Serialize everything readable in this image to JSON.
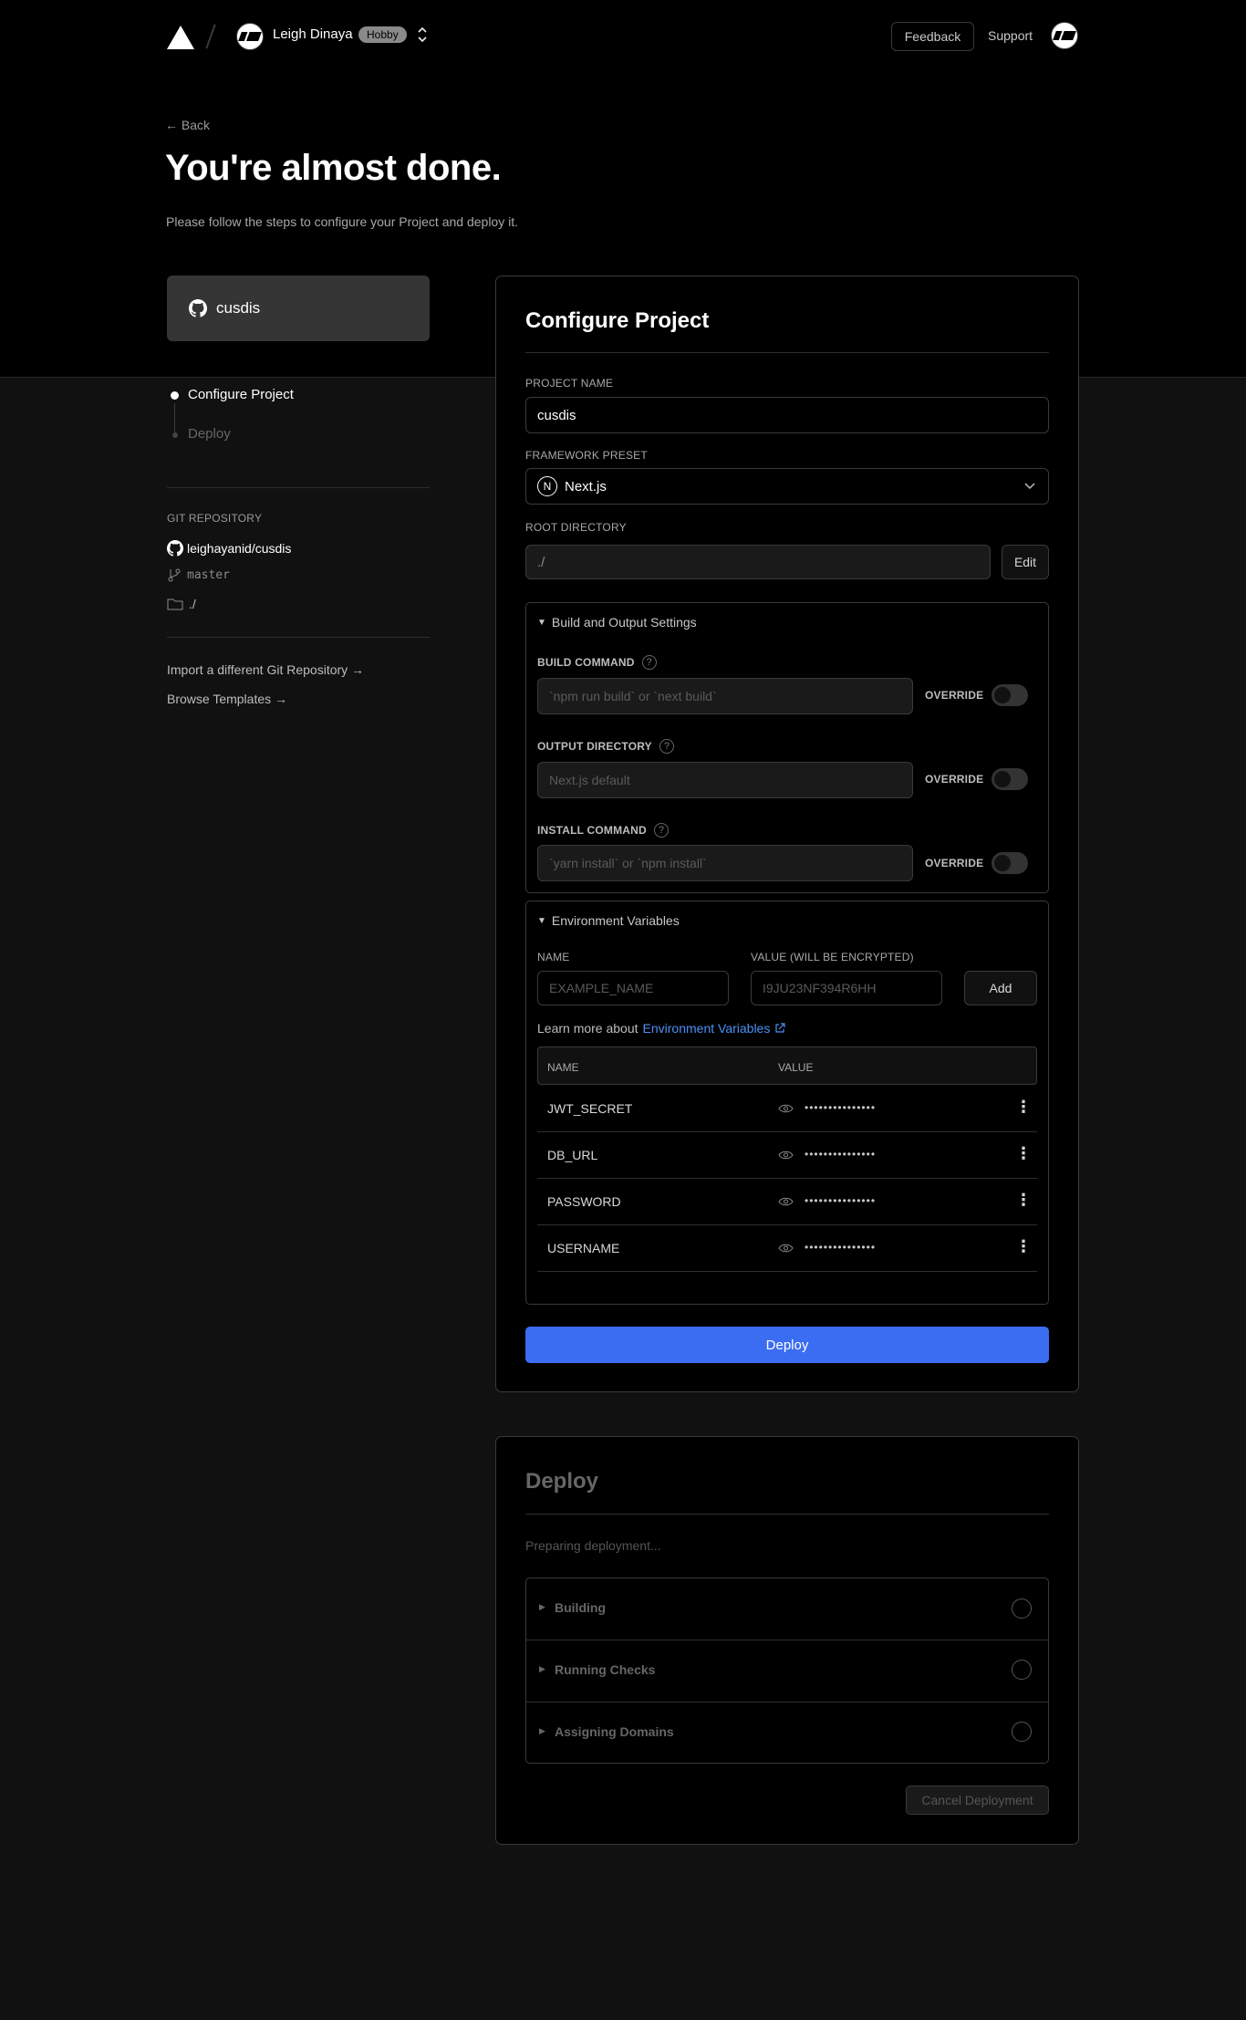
{
  "header": {
    "user_name": "Leigh Dinaya",
    "plan_badge": "Hobby",
    "feedback_label": "Feedback",
    "support_label": "Support"
  },
  "hero": {
    "back_label": "Back",
    "title": "You're almost done.",
    "subtitle": "Please follow the steps to configure your Project and deploy it."
  },
  "sidebar": {
    "repo_card_name": "cusdis",
    "steps": [
      {
        "label": "Configure Project",
        "active": true
      },
      {
        "label": "Deploy",
        "active": false
      }
    ],
    "git_section_label": "GIT REPOSITORY",
    "repo_full_name": "leighayanid/cusdis",
    "branch": "master",
    "directory": "./",
    "links": [
      "Import a different Git Repository →",
      "Browse Templates →"
    ]
  },
  "configure": {
    "title": "Configure Project",
    "project_name_label": "PROJECT NAME",
    "project_name_value": "cusdis",
    "framework_label": "FRAMEWORK PRESET",
    "framework_value": "Next.js",
    "root_dir_label": "ROOT DIRECTORY",
    "root_dir_value": "./",
    "edit_label": "Edit",
    "build_section_title": "Build and Output Settings",
    "build_command_label": "BUILD COMMAND",
    "build_command_placeholder": "`npm run build` or `next build`",
    "output_dir_label": "OUTPUT DIRECTORY",
    "output_dir_placeholder": "Next.js default",
    "install_command_label": "INSTALL COMMAND",
    "install_command_placeholder": "`yarn install` or `npm install`",
    "override_label": "OVERRIDE",
    "env_section_title": "Environment Variables",
    "env_name_label": "NAME",
    "env_value_label": "VALUE (WILL BE ENCRYPTED)",
    "env_name_placeholder": "EXAMPLE_NAME",
    "env_value_placeholder": "I9JU23NF394R6HH",
    "add_label": "Add",
    "learn_more_prefix": "Learn more about",
    "learn_more_link": "Environment Variables",
    "table_header_name": "NAME",
    "table_header_value": "VALUE",
    "env_vars": [
      {
        "name": "JWT_SECRET",
        "value": "•••••••••••••••"
      },
      {
        "name": "DB_URL",
        "value": "•••••••••••••••"
      },
      {
        "name": "PASSWORD",
        "value": "•••••••••••••••"
      },
      {
        "name": "USERNAME",
        "value": "•••••••••••••••"
      }
    ],
    "deploy_button": "Deploy"
  },
  "deploy": {
    "title": "Deploy",
    "status": "Preparing deployment...",
    "steps": [
      "Building",
      "Running Checks",
      "Assigning Domains"
    ],
    "cancel_label": "Cancel Deployment"
  },
  "colors": {
    "accent": "#3b6df2",
    "background": "#111111",
    "hero_background": "#000000"
  }
}
